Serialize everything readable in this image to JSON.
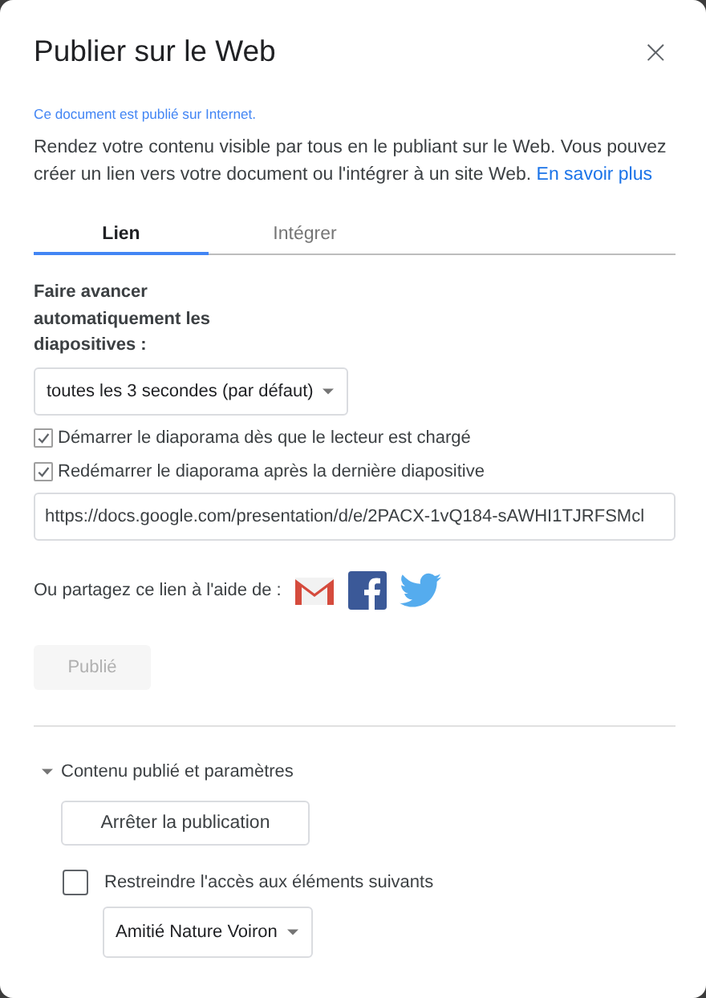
{
  "dialog": {
    "title": "Publier sur le Web",
    "close": "×"
  },
  "status_message": "Ce document est publié sur Internet.",
  "description": {
    "text": "Rendez votre contenu visible par tous en le publiant sur le Web. Vous pouvez créer un lien vers votre document ou l'intégrer à un site Web.",
    "link": "En savoir plus"
  },
  "tabs": [
    {
      "label": "Lien",
      "selected": true
    },
    {
      "label": "Intégrer",
      "selected": false
    }
  ],
  "auto_advance": {
    "label": "Faire avancer automatiquement les diapositives :",
    "value": "toutes les 3 secondes (par défaut)"
  },
  "options": [
    {
      "label": "Démarrer le diaporama dès que le lecteur est chargé",
      "checked": true
    },
    {
      "label": "Redémarrer le diaporama après la dernière diapositive",
      "checked": true
    }
  ],
  "link_field": {
    "value": "https://docs.google.com/presentation/d/e/2PACX-1vQ184-sAWHI1TJRFSMcl"
  },
  "share": {
    "label": "Ou partagez ce lien à l'aide de :"
  },
  "publish_button": {
    "label": "Publié",
    "disabled": true
  },
  "section": {
    "label": "Contenu publié et paramètres",
    "expanded": true,
    "stop_button": "Arrêter la publication",
    "restrict": {
      "label": "Restreindre l'accès aux éléments suivants",
      "checked": false
    },
    "group": {
      "value": "Amitié Nature Voiron"
    }
  }
}
